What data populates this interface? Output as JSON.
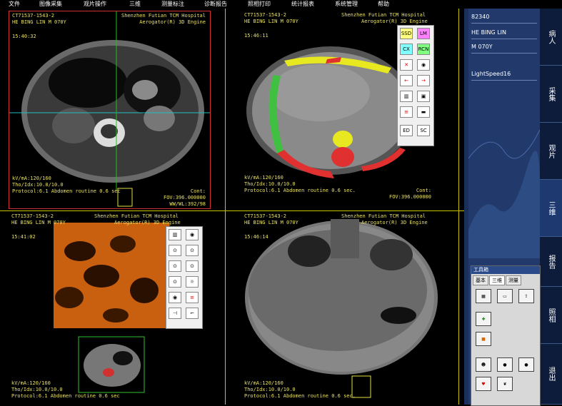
{
  "menu": [
    "文件",
    "图像采集",
    "观片操作",
    "三维",
    "测量标注",
    "诊断报告",
    "照相打印",
    "统计报表",
    "系统管理",
    "帮助"
  ],
  "viewports": {
    "top_left": {
      "id": "CT71537-1543-2",
      "patient": "HE BING LIN M 070Y",
      "time": "15:40:32",
      "hospital": "Shenzhen Futian TCM Hospital",
      "engine": "Aerogator(R) 3D Engine",
      "kv": "kV/mA:120/160",
      "tho": "Tho/Idx:10.0/10.0",
      "protocol": "Protocol:6.1 Abdomen routine 0.6 sec",
      "cont": "Cont:",
      "fov": "FOV:396.000000",
      "wwwl": "WW/WL:392/98"
    },
    "top_right": {
      "id": "CT71537-1543-2",
      "patient": "HE BING LIN M 070Y",
      "time": "15:46:11",
      "hospital": "Shenzhen Futian TCM Hospital",
      "engine": "Aerogator(R) 3D Engine",
      "kv": "kV/mA:120/160",
      "tho": "Tho/Idx:10.0/10.0",
      "protocol": "Protocol:6.1 Abdomen routine 0.6 sec.",
      "cont": "Cont:",
      "fov": "FOV:396.000000"
    },
    "bottom_left": {
      "id": "CT71537-1543-2",
      "patient": "HE BING LIN M 070Y",
      "time": "15:41:02",
      "hospital": "Shenzhen Futian TCM Hospital",
      "engine": "Aerogator(R) 3D Engine",
      "kv": "kV/mA:120/160",
      "tho": "Tho/Idx:10.0/10.0",
      "protocol": "Protocol:6.1 Abdomen routine 0.6 sec"
    },
    "bottom_right": {
      "id": "CT71537-1543-2",
      "patient": "HE BING LIN M 070Y",
      "time": "15:46:14",
      "hospital": "Shenzhen Futian TCM Hospital",
      "engine": "Aerogator(R) 3D Engine",
      "kv": "kV/mA:120/160",
      "tho": "Tho/Idx:10.0/10.0",
      "protocol": "Protocol:6.1 Abdomen routine 0.6 sec."
    }
  },
  "tools_top": [
    "SSD",
    "LM",
    "CX",
    "RCN",
    "",
    "",
    "",
    "",
    "",
    "",
    "",
    "",
    "ED",
    "SC"
  ],
  "side": {
    "patient_id": "82340",
    "patient_name": "HE BING LIN",
    "patient_sex_age": "M 070Y",
    "scanner": "LightSpeed16",
    "tabs": [
      "病人",
      "采集",
      "观片",
      "三维",
      "报告",
      "照相",
      "退出"
    ]
  },
  "toolbox": {
    "title": "工具箱",
    "tabs": [
      "基本",
      "三维",
      "测量"
    ]
  }
}
